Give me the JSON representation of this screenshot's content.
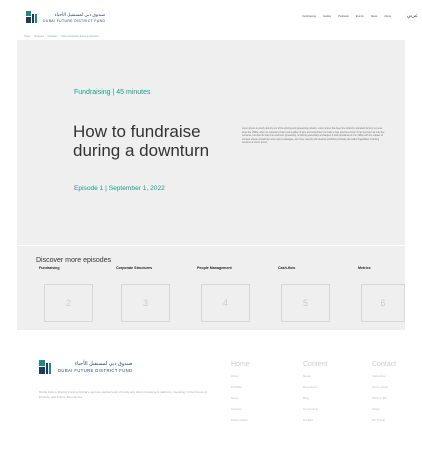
{
  "header": {
    "logo_ar": "صندوق دبي لمستقبل الأحياء",
    "logo_en": "DUBAI FUTURE DISTRICT FUND",
    "nav": [
      "Fundraising",
      "Guides",
      "Podcasts",
      "Events",
      "News",
      "About"
    ],
    "lang": "عربي"
  },
  "breadcrumb": [
    "Home",
    "Podcasts",
    "Podcasts",
    "How to fundraise during a downturn"
  ],
  "hero": {
    "meta": "Fundraising  |  45 minutes",
    "title": "How to fundraise during a downturn",
    "episode": "Episode 1  |  September 1, 2022",
    "description": "Lorem ipsum is simply dummy text of the printing and typesetting industry. Lorem Ipsum has been the industry's standard dummy text ever since the 1500s, when an unknown printer took a galley of type and scrambled it to make a type specimen book. It has survived not only five centuries, but also the leap into electronic typesetting, remaining essentially unchanged. It was popularised in the 1960s with the release of Letraset sheets containing Lorem Ipsum passages, and more recently with desktop publishing software like Aldus PageMaker including versions of Lorem Ipsum."
  },
  "discover": {
    "title": "Discover more episodes",
    "categories": [
      "Fundraising",
      "Corporate Structures",
      "People Management",
      "Cash-flow",
      "Metrics"
    ],
    "cards": [
      "2",
      "3",
      "4",
      "5",
      "6"
    ]
  },
  "footer": {
    "logo_ar": "صندوق دبي لمستقبل الأحياء",
    "logo_en": "DUBAI FUTURE DISTRICT FUND",
    "description": "Dubai Future District Fund is Dubai's venture capital fund of funds and direct investment platform, investing in the Future of Finance and Future Economies.",
    "columns": [
      {
        "head": "Home",
        "items": [
          "About",
          "Portfolio",
          "Team",
          "Careers",
          "Partnerships"
        ]
      },
      {
        "head": "Content",
        "items": [
          "News",
          "Resources",
          "Blog",
          "Community",
          "Toolkits"
        ]
      },
      {
        "head": "Contact",
        "items": [
          "Subscribe",
          "Get in touch",
          "Pitch to DF",
          "FAQs",
          "DF Portal"
        ]
      }
    ]
  },
  "colors": {
    "accent": "#1a9a8f",
    "navy": "#1f3a5f",
    "panel": "#efefef"
  }
}
